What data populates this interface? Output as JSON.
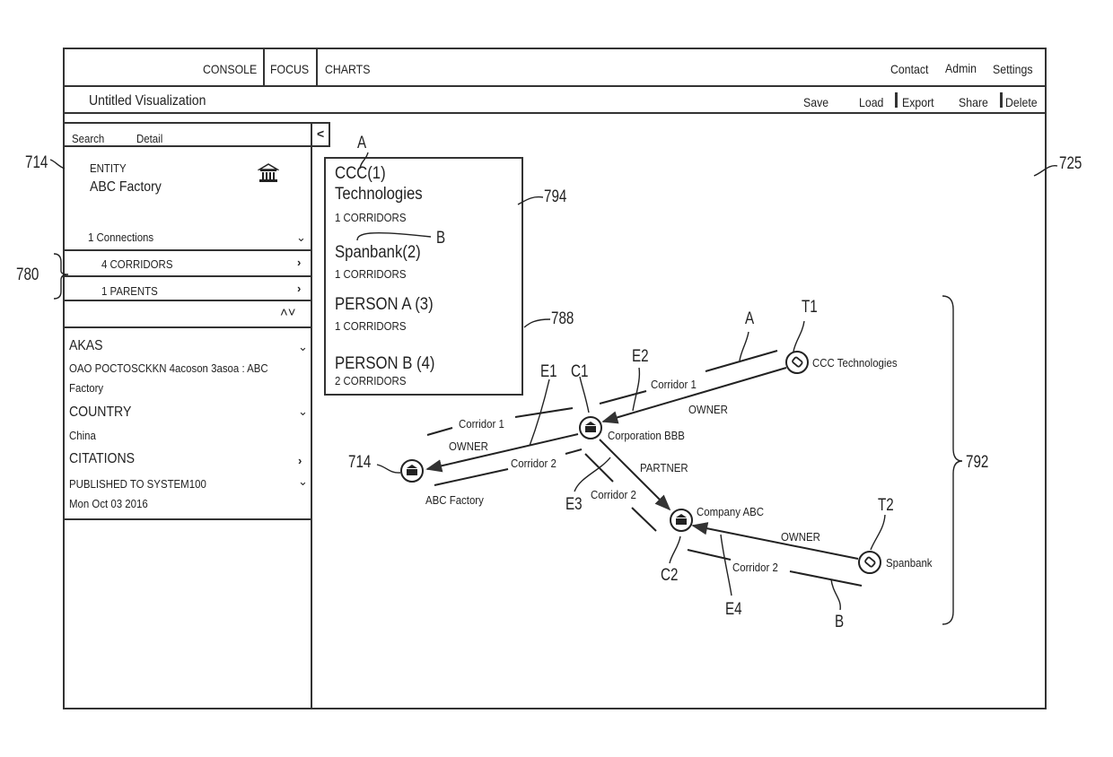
{
  "top_nav": {
    "tabs": [
      "CONSOLE",
      "FOCUS",
      "CHARTS"
    ],
    "right_links": [
      "Contact",
      "Admin",
      "Settings"
    ]
  },
  "toolbar": {
    "title": "Untitled Visualization",
    "actions": [
      "Save",
      "Load",
      "Export",
      "Share",
      "Delete"
    ]
  },
  "left_panel": {
    "tabs": [
      "Search",
      "Detail"
    ],
    "collapse_label": "<",
    "entity_type": "ENTITY",
    "entity_name": "ABC Factory",
    "entity_icon": "bank-icon",
    "connections_label": "1 Connections",
    "rows": [
      "4 CORRIDORS",
      "1 PARENTS"
    ],
    "sort_glyph": "^v",
    "sections": [
      {
        "title": "AKAS",
        "value_line1": "OAO POCTOSCKKN 4acoson 3asoa : ABC",
        "value_line2": "Factory"
      },
      {
        "title": "COUNTRY",
        "value_line1": "China"
      },
      {
        "title": "CITATIONS"
      },
      {
        "title": "PUBLISHED TO SYSTEM100",
        "value_line1": "Mon Oct 03 2016"
      }
    ]
  },
  "legend_box": {
    "items": [
      {
        "name_line1": "CCC(1)",
        "name_line2": "Technologies",
        "count": "1 CORRIDORS"
      },
      {
        "name_line1": "Spanbank(2)",
        "count": "1 CORRIDORS"
      },
      {
        "name_line1": "PERSON A (3)",
        "count": "1 CORRIDORS"
      },
      {
        "name_line1": "PERSON B (4)",
        "count": "2 CORRIDORS"
      }
    ]
  },
  "graph": {
    "nodes": [
      {
        "id": "abc_factory",
        "label": "ABC Factory",
        "icon": "bank-icon"
      },
      {
        "id": "corp_bbb",
        "label": "Corporation BBB",
        "icon": "bank-icon"
      },
      {
        "id": "company_abc",
        "label": "Company ABC",
        "icon": "bank-icon"
      },
      {
        "id": "ccc_tech",
        "label": "CCC Technologies",
        "icon": "tag-icon"
      },
      {
        "id": "spanbank",
        "label": "Spanbank",
        "icon": "tag-icon"
      }
    ],
    "edges": [
      {
        "from": "corp_bbb",
        "to": "abc_factory",
        "label": "OWNER"
      },
      {
        "from": "ccc_tech",
        "to": "corp_bbb",
        "label": "OWNER"
      },
      {
        "from": "corp_bbb",
        "to": "company_abc",
        "label": "PARTNER"
      },
      {
        "from": "spanbank",
        "to": "company_abc",
        "label": "OWNER"
      }
    ],
    "corridor_labels": [
      "Corridor 1",
      "Corridor 2",
      "Corridor 1",
      "Corridor 2",
      "Corridor 2"
    ]
  },
  "annotations": {
    "ref_714_panel": "714",
    "ref_780": "780",
    "ref_725": "725",
    "ref_794": "794",
    "ref_788": "788",
    "ref_792": "792",
    "ref_714_graph": "714",
    "letter_A_box": "A",
    "letter_B_box": "B",
    "letter_A_graph": "A",
    "letter_B_graph": "B",
    "E1": "E1",
    "E2": "E2",
    "E3": "E3",
    "E4": "E4",
    "C1": "C1",
    "C2": "C2",
    "T1": "T1",
    "T2": "T2"
  }
}
